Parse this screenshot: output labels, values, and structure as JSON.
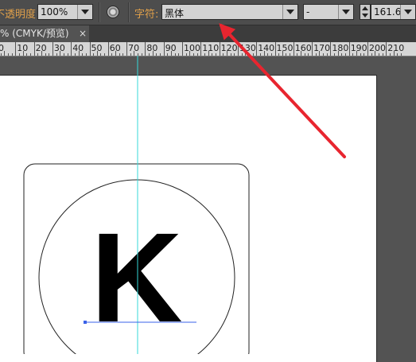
{
  "toolbar": {
    "opacity_label": "不透明度:",
    "opacity_value": "100%",
    "char_label": "字符:",
    "font_family": "黑体",
    "font_style": "-",
    "font_size": "161.6"
  },
  "tab": {
    "title": "% (CMYK/预览)",
    "close": "×"
  },
  "ruler": {
    "ticks": [
      "0",
      "10",
      "20",
      "30",
      "40",
      "50",
      "60",
      "70",
      "80",
      "90",
      "100",
      "110",
      "120",
      "130",
      "140",
      "150",
      "160",
      "170",
      "180",
      "190",
      "200",
      "210"
    ]
  },
  "artwork": {
    "letter": "K"
  },
  "colors": {
    "guide": "#36d8d8",
    "selection": "#3a62e8",
    "annotation_arrow": "#e8252f",
    "label": "#e0a04a"
  }
}
